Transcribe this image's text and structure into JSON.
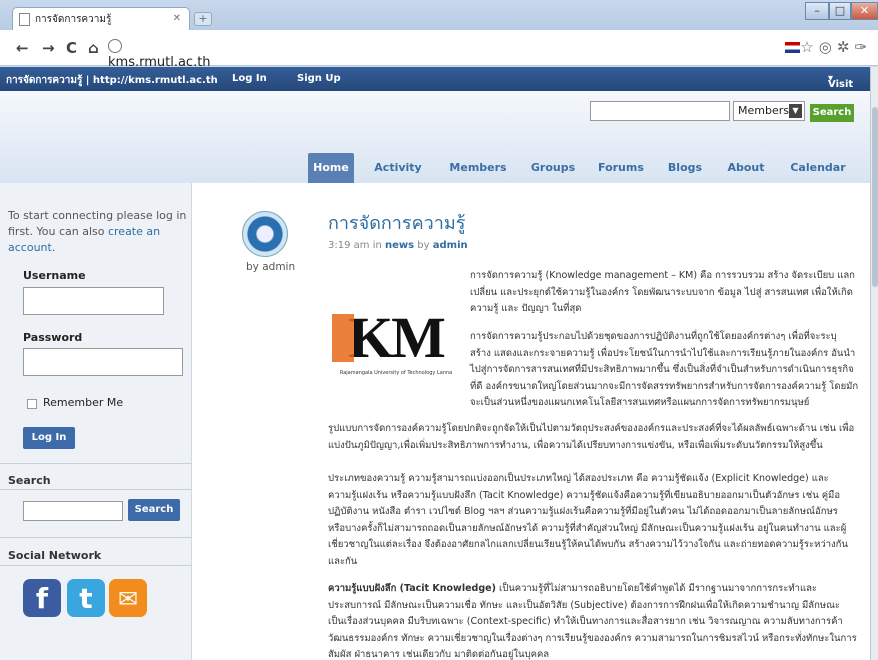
{
  "browser": {
    "tab_title": "การจัดการความรู้",
    "url": "kms.rmutl.ac.th"
  },
  "adminbar": {
    "site": "การจัดการความรู้ | http://kms.rmutl.ac.th",
    "login": "Log In",
    "signup": "Sign Up",
    "visit": "Visit"
  },
  "header": {
    "search_scope": "Members",
    "search_button": "Search",
    "nav": [
      "Home",
      "Activity",
      "Members",
      "Groups",
      "Forums",
      "Blogs",
      "About",
      "Calendar"
    ],
    "active_nav": "Home"
  },
  "sidebar": {
    "intro_1": "To start connecting please log in",
    "intro_2": "first. You can also",
    "intro_link": "create an",
    "intro_3": "account",
    "username_label": "Username",
    "password_label": "Password",
    "remember_label": "Remember Me",
    "login_button": "Log In",
    "search_heading": "Search",
    "search_button": "Search",
    "social_heading": "Social Network",
    "social_icons": [
      "facebook-icon",
      "twitter-icon",
      "email-icon"
    ]
  },
  "post": {
    "title": "การจัดการความรู้",
    "time": "3:19 am",
    "in_word": "in",
    "category": "news",
    "by_word": "by",
    "author": "admin",
    "avatar_by": "by admin",
    "logo_text": "KM",
    "logo_caption": "Rajamangala University of Technology Lanna",
    "p1": [
      "การจัดการความรู้ (Knowledge management – KM) คือ การรวบรวม สร้าง จัดระเบียบ แลก",
      "เปลี่ยน และประยุกต์ใช้ความรู้ในองค์กร โดยพัฒนาระบบจาก ข้อมูล ไปสู่ สารสนเทศ เพื่อให้เกิด",
      "ความรู้ และ ปัญญา ในที่สุด"
    ],
    "p2": [
      "การจัดการความรู้ประกอบไปด้วยชุดของการปฏิบัติงานที่ถูกใช้โดยองค์กรต่างๆ เพื่อที่จะระบุ",
      "สร้าง แสดงและกระจายความรู้ เพื่อประโยชน์ในการนำไปใช้และการเรียนรู้ภายในองค์กร อันนำ",
      "ไปสู่การจัดการสารสนเทศที่มีประสิทธิภาพมากขึ้น ซึ่งเป็นสิ่งที่จำเป็นสำหรับการดำเนินการธุรกิจ",
      "ที่ดี องค์กรขนาดใหญ่โดยส่วนมากจะมีการจัดสรรทรัพยากรสำหรับการจัดการองค์ความรู้ โดยมัก",
      "จะเป็นส่วนหนึ่งของแผนกเทคโนโลยีสารสนเทศหรือแผนกการจัดการทรัพยากรมนุษย์"
    ],
    "p3": [
      "รูปแบบการจัดการองค์ความรู้โดยปกติจะถูกจัดให้เป็นไปตามวัตถุประสงค์ขององค์กรและประสงค์ที่จะได้ผลลัพธ์เฉพาะด้าน เช่น เพื่อ",
      "แบ่งปันภูมิปัญญา,เพื่อเพิ่มประสิทธิภาพการทำงาน, เพื่อความได้เปรียบทางการแข่งขัน, หรือเพื่อเพิ่มระดับนวัตกรรมให้สูงขึ้น"
    ],
    "p4": [
      "ประเภทของความรู้ ความรู้สามารถแบ่งออกเป็นประเภทใหญ่ ได้สองประเภท คือ ความรู้ชัดแจ้ง (Explicit Knowledge) และ",
      "ความรู้แฝงเร้น หรือความรู้แบบฝังลึก (Tacit Knowledge) ความรู้ชัดแจ้งคือความรู้ที่เขียนอธิบายออกมาเป็นตัวอักษร เช่น คู่มือ",
      "ปฏิบัติงาน หนังสือ ตำรา เวปไซต์ Blog ฯลฯ ส่วนความรู้แฝงเร้นคือความรู้ที่มีอยู่ในตัวคน ไม่ได้ถอดออกมาเป็นลายลักษณ์อักษร",
      "หรือบางครั้งก็ไม่สามารถถอดเป็นลายลักษณ์อักษรได้ ความรู้ที่สำคัญส่วนใหญ่ มีลักษณะเป็นความรู้แฝงเร้น อยู่ในคนทำงาน และผู้",
      "เชี่ยวชาญในแต่ละเรื่อง จึงต้องอาศัยกลไกแลกเปลี่ยนเรียนรู้ให้คนได้พบกัน สร้างความไว้วางใจกัน และถ่ายทอดความรู้ระหว่างกัน",
      "และกัน"
    ],
    "p5_bold": "ความรู้แบบฝังลึก (Tacit Knowledge)",
    "p5": [
      " เป็นความรู้ที่ไม่สามารถอธิบายโดยใช้คำพูดได้ มีรากฐานมาจากการกระทำและ",
      "ประสบการณ์ มีลักษณะเป็นความเชื่อ ทักษะ และเป็นอัตวิสัย (Subjective) ต้องการการฝึกฝนเพื่อให้เกิดความชำนาญ มีลักษณะ",
      "เป็นเรื่องส่วนบุคคล มีบริบทเฉพาะ (Context-specific) ทำให้เป็นทางการและสื่อสารยาก เช่น วิจารณญาณ ความลับทางการค้า",
      "วัฒนธรรมองค์กร ทักษะ ความเชี่ยวชาญในเรื่องต่างๆ การเรียนรู้ขององค์กร ความสามารถในการชิมรสไวน์ หรือกระทั่งทักษะในการ",
      "สัมผัส ฝ่าธนาคาร เช่นเดียวกับ มาติดต่อกันอยู่ในบุคคล"
    ]
  }
}
